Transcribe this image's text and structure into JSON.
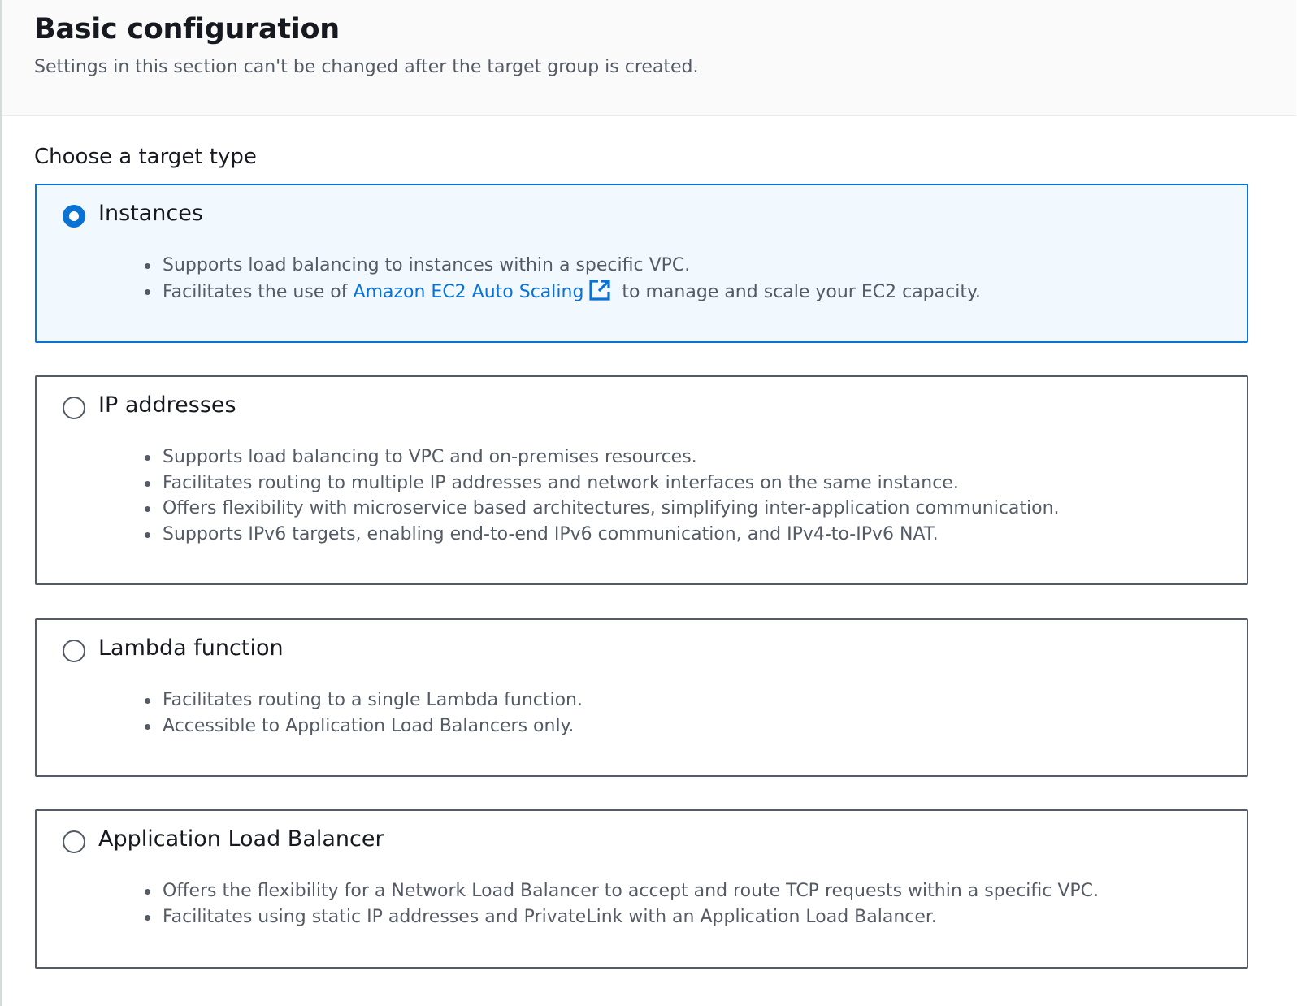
{
  "header": {
    "title": "Basic configuration",
    "subtitle": "Settings in this section can't be changed after the target group is created."
  },
  "target_type": {
    "label": "Choose a target type",
    "selected": "Instances",
    "options": [
      {
        "title": "Instances",
        "selected": true,
        "bullets": [
          "Supports load balancing to instances within a specific VPC."
        ],
        "link_bullet": {
          "prefix": "Facilitates the use of ",
          "link_text": "Amazon EC2 Auto Scaling",
          "link_icon": "external-link-icon",
          "suffix": " to manage and scale your EC2 capacity."
        }
      },
      {
        "title": "IP addresses",
        "selected": false,
        "bullets": [
          "Supports load balancing to VPC and on-premises resources.",
          "Facilitates routing to multiple IP addresses and network interfaces on the same instance.",
          "Offers flexibility with microservice based architectures, simplifying inter-application communication.",
          "Supports IPv6 targets, enabling end-to-end IPv6 communication, and IPv4-to-IPv6 NAT."
        ]
      },
      {
        "title": "Lambda function",
        "selected": false,
        "bullets": [
          "Facilitates routing to a single Lambda function.",
          "Accessible to Application Load Balancers only."
        ]
      },
      {
        "title": "Application Load Balancer",
        "selected": false,
        "bullets": [
          "Offers the flexibility for a Network Load Balancer to accept and route TCP requests within a specific VPC.",
          "Facilitates using static IP addresses and PrivateLink with an Application Load Balancer."
        ]
      }
    ]
  },
  "colors": {
    "accent": "#0972d3",
    "selected_background": "#f1f8fe",
    "border": "#545b64",
    "header_background": "#fafafa",
    "body_text": "#545b64",
    "heading_text": "#16191f"
  }
}
